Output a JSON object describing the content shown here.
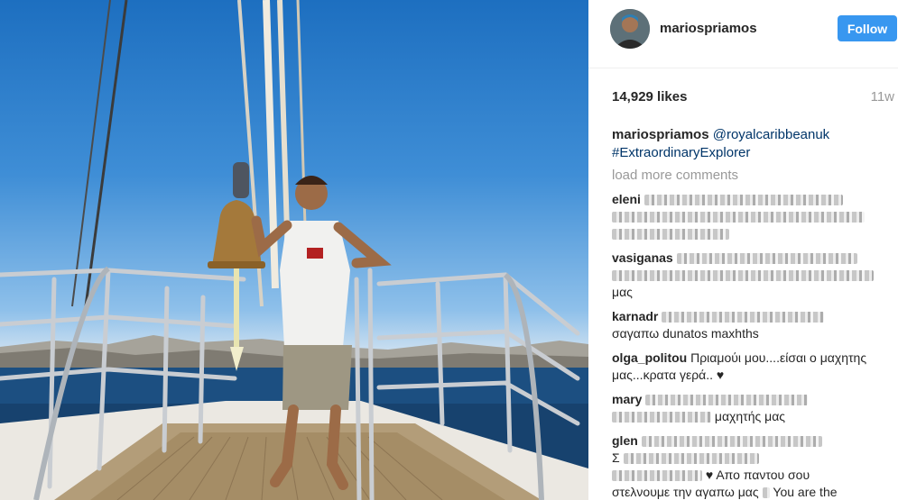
{
  "header": {
    "username": "mariospriamos",
    "follow_label": "Follow"
  },
  "post": {
    "likes": "14,929 likes",
    "time_ago": "11w",
    "caption_user": "mariospriamos",
    "caption_mention": "@royalcaribbeanuk",
    "caption_hashtag": "#ExtraordinaryExplorer",
    "load_more": "load more comments"
  },
  "comments": [
    {
      "user": "olga_politou",
      "text": "Πριαμούι μου....είσαι ο μαχητης μας...κρατα γερά..",
      "heart": "♥"
    },
    {
      "user": "",
      "text": "μαχητής μας",
      "heart": ""
    },
    {
      "user": "",
      "text": "σαγαπω",
      "heart": ""
    },
    {
      "user": "",
      "text": "μας",
      "heart": ""
    },
    {
      "user": "",
      "text": "dunatos maxhths",
      "heart": ""
    },
    {
      "user": "",
      "text": "Σ",
      "heart": ""
    },
    {
      "user": "",
      "text": "Απο παντου σου",
      "heart": "♥"
    },
    {
      "user": "",
      "text": "στελνουμε την αγαπω μας",
      "heart": ""
    },
    {
      "user": "",
      "text": "You are the",
      "heart": ""
    }
  ],
  "obscured_users": [
    "eleni",
    "vasiganas",
    "karnadr",
    "mary",
    "glen"
  ],
  "icons": {
    "avatar": "profile-avatar"
  },
  "colors": {
    "follow": "#3897f0",
    "link": "#003569",
    "muted": "#999999"
  }
}
